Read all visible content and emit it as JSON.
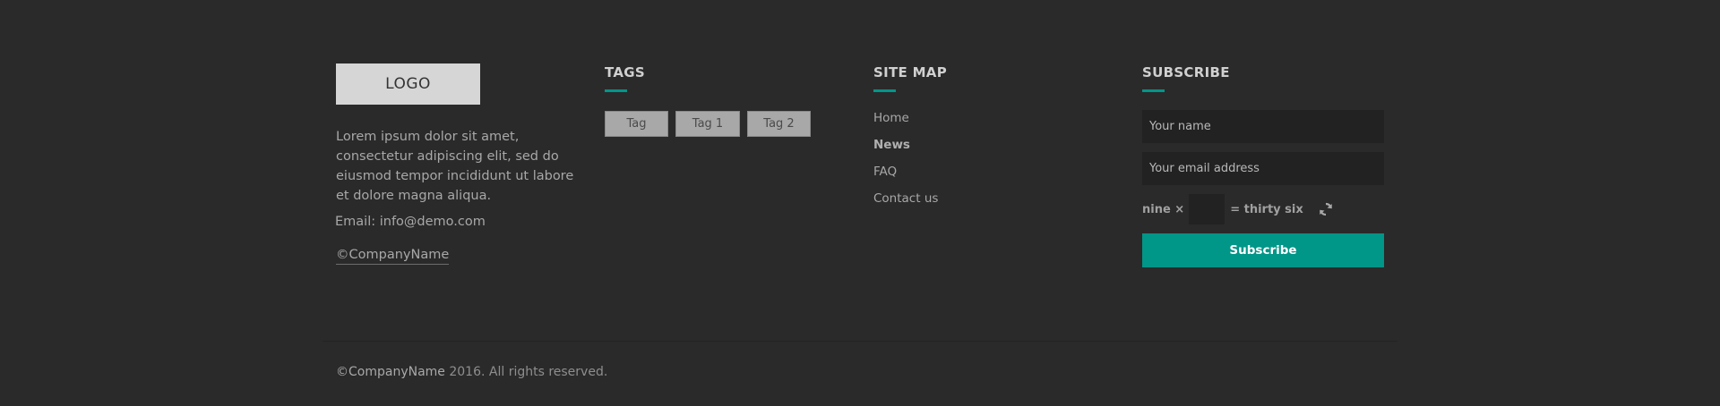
{
  "about": {
    "logo": "LOGO",
    "text": "Lorem ipsum dolor sit amet, consectetur adipiscing elit, sed do eiusmod tempor incididunt ut labore et dolore magna aliqua.",
    "email": "Email: info@demo.com",
    "company": "©CompanyName"
  },
  "tags": {
    "title": "TAGS",
    "items": [
      "Tag",
      "Tag 1",
      "Tag 2"
    ]
  },
  "sitemap": {
    "title": "SITE MAP",
    "items": [
      "Home",
      "News",
      "FAQ",
      "Contact us"
    ]
  },
  "subscribe": {
    "title": "SUBSCRIBE",
    "name_placeholder": "Your name",
    "email_placeholder": "Your email address",
    "captcha_left": "nine ×",
    "captcha_right": "= thirty six",
    "button": "Subscribe"
  },
  "bottom": {
    "brand": "©CompanyName",
    "rights": " 2016. All rights reserved."
  },
  "colors": {
    "background": "#2a2a2a",
    "accent": "#009688"
  },
  "icons": {
    "refresh": "refresh-icon"
  }
}
